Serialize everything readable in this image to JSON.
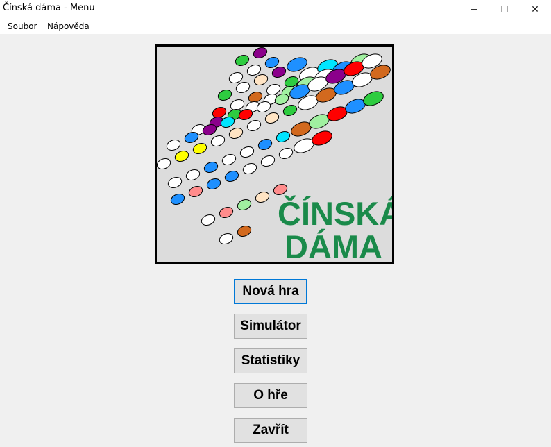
{
  "window": {
    "title": "Čínská dáma - Menu",
    "controls": {
      "minimize_icon": "minimize-icon",
      "maximize_icon": "maximize-icon",
      "close_glyph": "✕"
    }
  },
  "menu": {
    "items": [
      {
        "label": "Soubor"
      },
      {
        "label": "Nápověda"
      }
    ]
  },
  "logo": {
    "line1": "ČÍNSKÁ",
    "line2": "DÁMA",
    "text_color": "#1a8a4a",
    "background": "#dcdcdc"
  },
  "buttons": [
    {
      "label": "Nová hra",
      "focused": true
    },
    {
      "label": "Simulátor"
    },
    {
      "label": "Statistiky"
    },
    {
      "label": "O hře"
    },
    {
      "label": "Zavřít"
    }
  ],
  "colors": {
    "window_bg": "#f0f0f0",
    "button_bg": "#e1e1e1",
    "focus_border": "#0078d7"
  }
}
